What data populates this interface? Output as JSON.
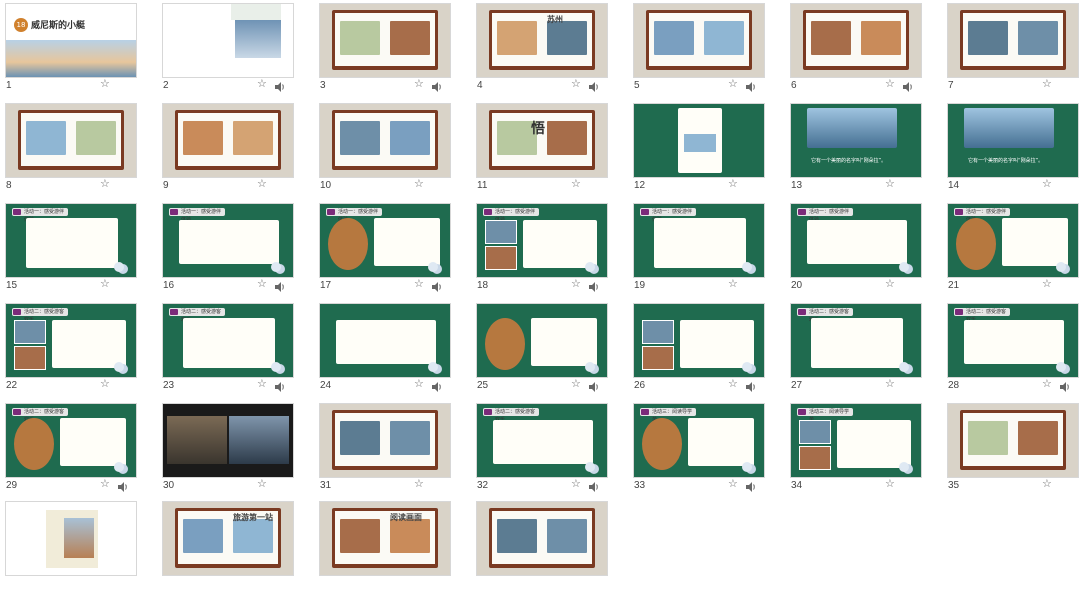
{
  "slides": [
    {
      "num": "1",
      "title_tag": "18",
      "title": "威尼斯的小艇"
    },
    {
      "num": "2"
    },
    {
      "num": "3"
    },
    {
      "num": "4",
      "title": "苏州"
    },
    {
      "num": "5"
    },
    {
      "num": "6"
    },
    {
      "num": "7"
    },
    {
      "num": "8"
    },
    {
      "num": "9"
    },
    {
      "num": "10"
    },
    {
      "num": "11",
      "title": "悟"
    },
    {
      "num": "12"
    },
    {
      "num": "13",
      "caption": "它有一个美丽的名字叫“刚朵拉”。"
    },
    {
      "num": "14",
      "caption": "它有一个美丽的名字叫“刚朵拉”。"
    },
    {
      "num": "15",
      "tag": "活动一：感受游伴体验"
    },
    {
      "num": "16",
      "tag": "活动一：感受游伴体验"
    },
    {
      "num": "17",
      "tag": "活动一：感受游伴体验"
    },
    {
      "num": "18",
      "tag": "活动一：感受游伴体验"
    },
    {
      "num": "19",
      "tag": "活动一：感受游伴体验"
    },
    {
      "num": "20",
      "tag": "活动一：感受游伴体验"
    },
    {
      "num": "21",
      "tag": "活动一：感受游伴体验"
    },
    {
      "num": "22",
      "tag": "活动二：感受游客欢乐"
    },
    {
      "num": "23",
      "tag": "活动二：感受游客欢乐"
    },
    {
      "num": "24"
    },
    {
      "num": "25"
    },
    {
      "num": "26"
    },
    {
      "num": "27",
      "tag": "活动二：感受游客欢乐"
    },
    {
      "num": "28",
      "tag": "活动二：感受游客欢乐"
    },
    {
      "num": "29",
      "tag": "活动二：感受游客欢乐"
    },
    {
      "num": "30"
    },
    {
      "num": "31"
    },
    {
      "num": "32",
      "tag": "活动二：感受游客欢乐"
    },
    {
      "num": "33",
      "tag": "活动三：阅读导学单"
    },
    {
      "num": "34",
      "tag": "活动三：阅读导学单"
    },
    {
      "num": "35"
    },
    {
      "num": ""
    },
    {
      "num": "",
      "title": "旅游第一站"
    },
    {
      "num": "",
      "title": "阅读画面"
    },
    {
      "num": ""
    }
  ],
  "icons": {
    "star": "star-icon",
    "audio": "audio-icon"
  },
  "colors": {
    "green": "#1f6b4f",
    "book": "#7a3a22",
    "purple": "#7b2b7a",
    "red": "#c0392b"
  }
}
